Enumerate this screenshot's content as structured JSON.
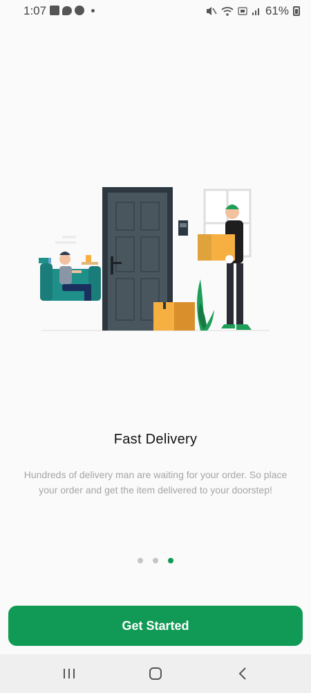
{
  "status_bar": {
    "time": "1:07",
    "battery_text": "61%",
    "icons": [
      "gallery-icon",
      "chat-icon",
      "phone-icon",
      "mute-icon",
      "wifi-icon",
      "lte-icon",
      "signal-icon",
      "battery-icon"
    ]
  },
  "onboarding": {
    "title": "Fast Delivery",
    "description": "Hundreds of delivery man are waiting for your order. So place your order and get the item delivered to your doorstep!",
    "page_count": 3,
    "active_page": 3,
    "button_label": "Get Started"
  },
  "colors": {
    "accent": "#109a55",
    "title": "#111111",
    "description": "#a5a5a5",
    "dot_inactive": "#c5c5c5"
  },
  "nav_bar": {
    "items": [
      "recent-apps-icon",
      "home-icon",
      "back-icon"
    ]
  }
}
